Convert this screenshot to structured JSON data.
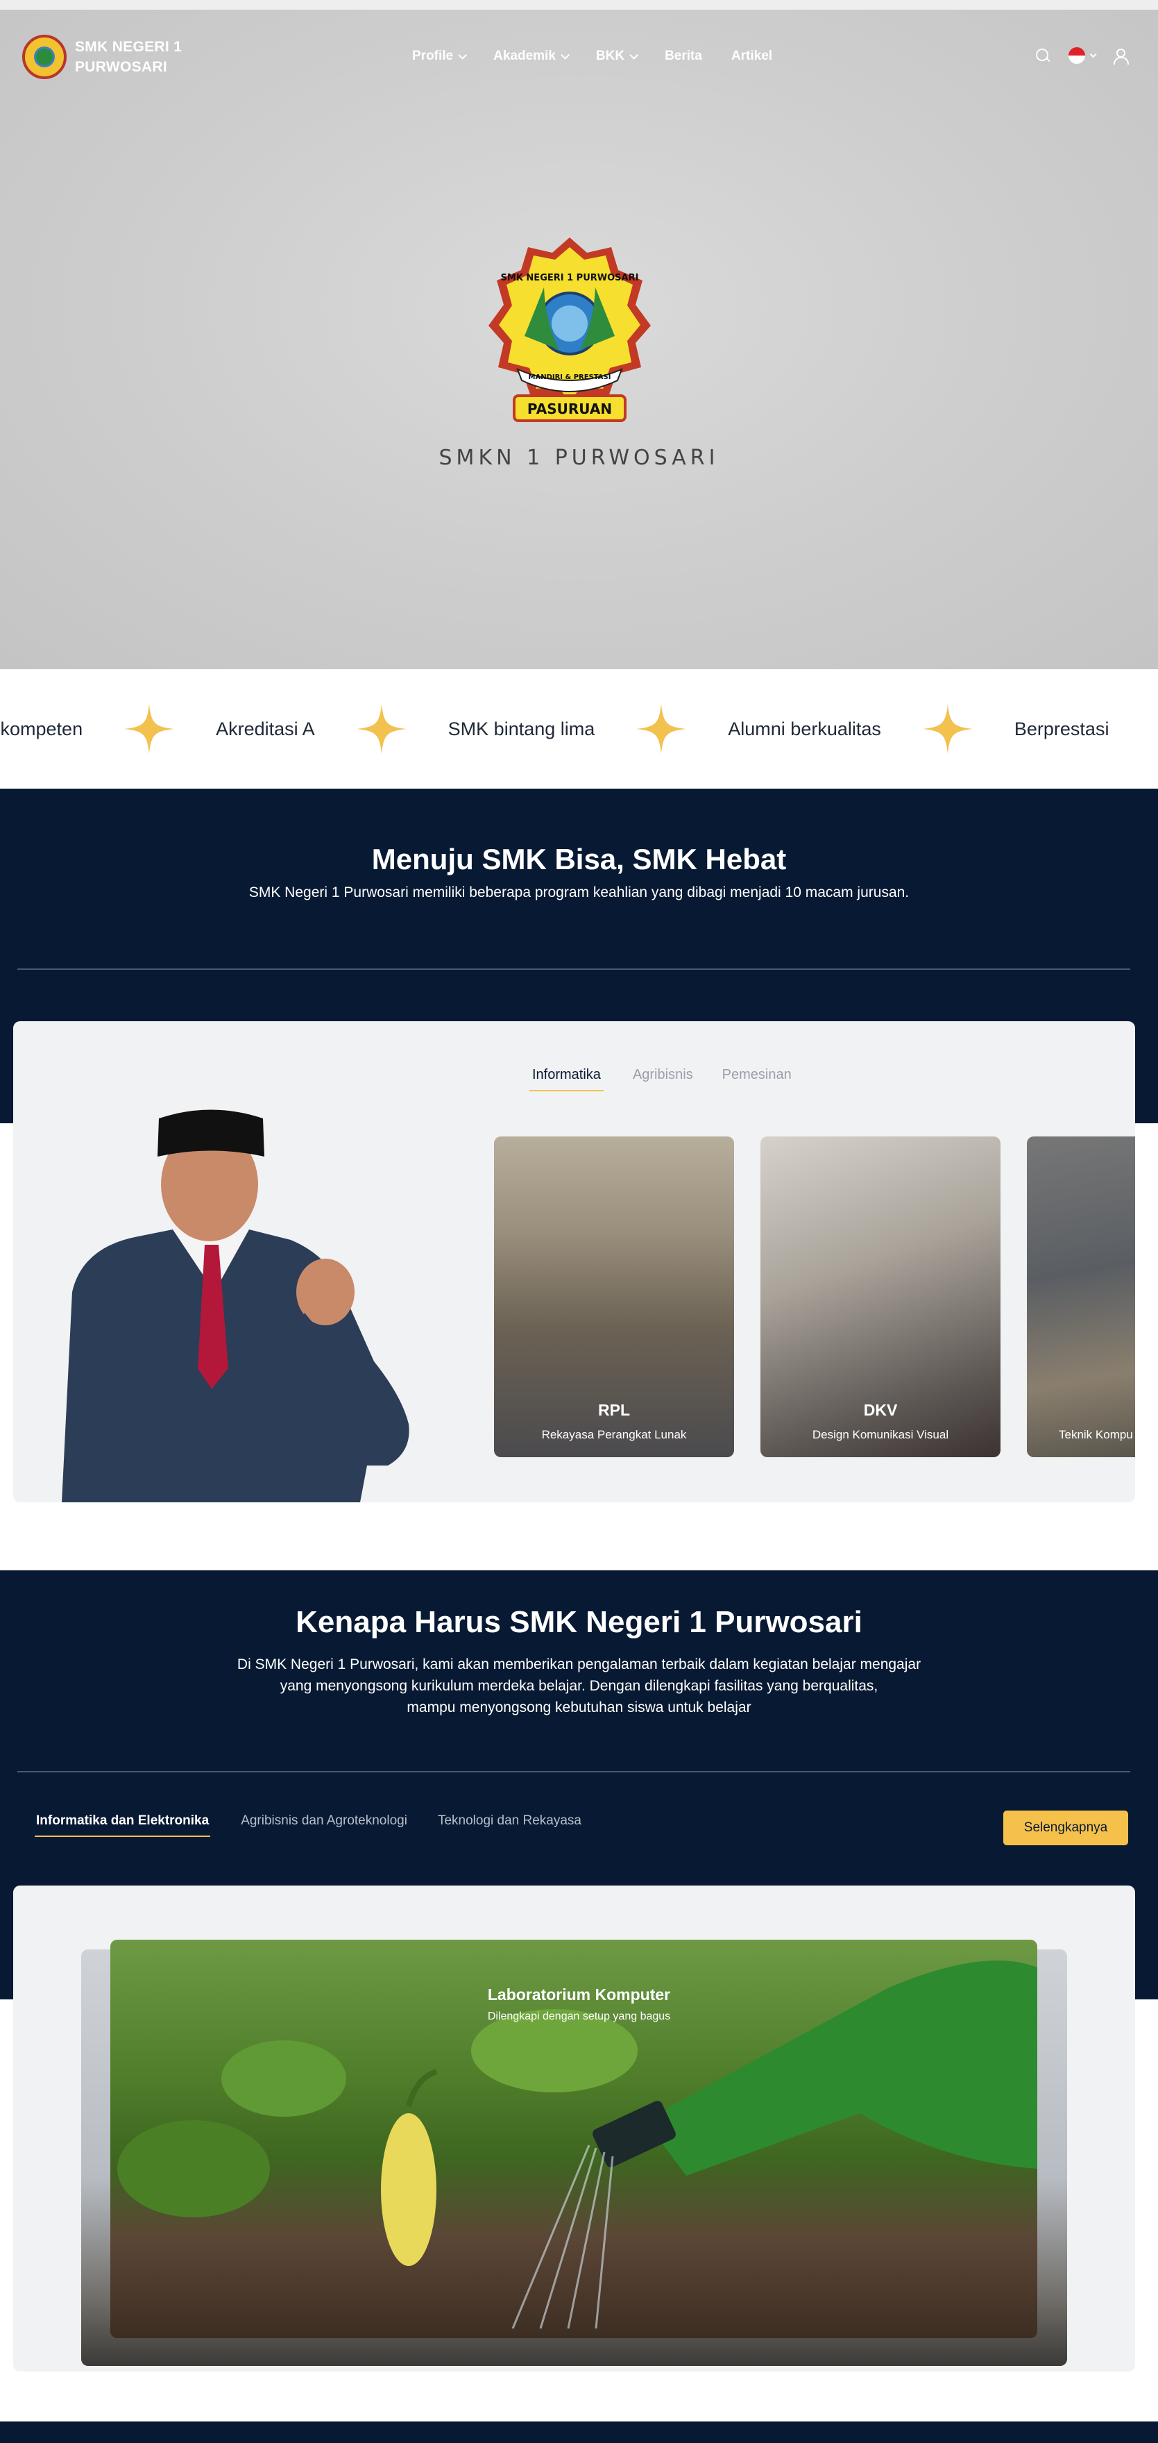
{
  "brand": {
    "line1": "SMK NEGERI 1",
    "line2": "PURWOSARI"
  },
  "nav": {
    "items": [
      {
        "label": "Profile",
        "dropdown": true
      },
      {
        "label": "Akademik",
        "dropdown": true
      },
      {
        "label": "BKK",
        "dropdown": true
      },
      {
        "label": "Berita",
        "dropdown": false
      },
      {
        "label": "Artikel",
        "dropdown": false
      }
    ],
    "icons": [
      "search-icon",
      "indonesia-flag-icon",
      "user-icon"
    ]
  },
  "hero": {
    "crest_top": "SMK NEGERI 1 PURWOSARI",
    "crest_ribbon": "MANDIRI & PRESTASI",
    "crest_bottom": "PASURUAN",
    "caption": "SMKN 1 PURWOSARI"
  },
  "marquee": {
    "items": [
      "g kompeten",
      "Akreditasi A",
      "SMK bintang lima",
      "Alumni berkualitas",
      "Berprestasi"
    ],
    "accent": "#f2c14e"
  },
  "jurusan": {
    "title": "Menuju SMK Bisa, SMK Hebat",
    "subtitle": "SMK Negeri 1 Purwosari memiliki beberapa program keahlian yang dibagi menjadi 10 macam jurusan.",
    "tabs": [
      "Informatika",
      "Agribisnis",
      "Pemesinan"
    ],
    "active_tab": "Informatika",
    "programs": [
      {
        "code": "RPL",
        "name": "Rekayasa Perangkat Lunak"
      },
      {
        "code": "DKV",
        "name": "Design Komunikasi Visual"
      },
      {
        "code": "",
        "name": "Teknik Kompu"
      }
    ]
  },
  "kenapa": {
    "title": "Kenapa Harus SMK Negeri 1 Purwosari",
    "subtitle_lines": [
      "Di SMK Negeri 1 Purwosari, kami akan memberikan pengalaman terbaik dalam kegiatan belajar mengajar",
      "yang menyongsong kurikulum merdeka belajar. Dengan dilengkapi fasilitas yang berqualitas,",
      "mampu menyongsong kebutuhan siswa untuk belajar"
    ],
    "tabs": [
      "Informatika dan Elektronika",
      "Agribisnis dan Agroteknologi",
      "Teknologi dan Rekayasa"
    ],
    "active_tab": "Informatika dan Elektronika",
    "button_label": "Selengkapnya",
    "slide": {
      "title": "Laboratorium Komputer",
      "subtitle": "Dilengkapi dengan setup yang bagus"
    }
  },
  "colors": {
    "navy": "#081a33",
    "accent": "#f5c14b",
    "card": "#f1f2f4"
  }
}
